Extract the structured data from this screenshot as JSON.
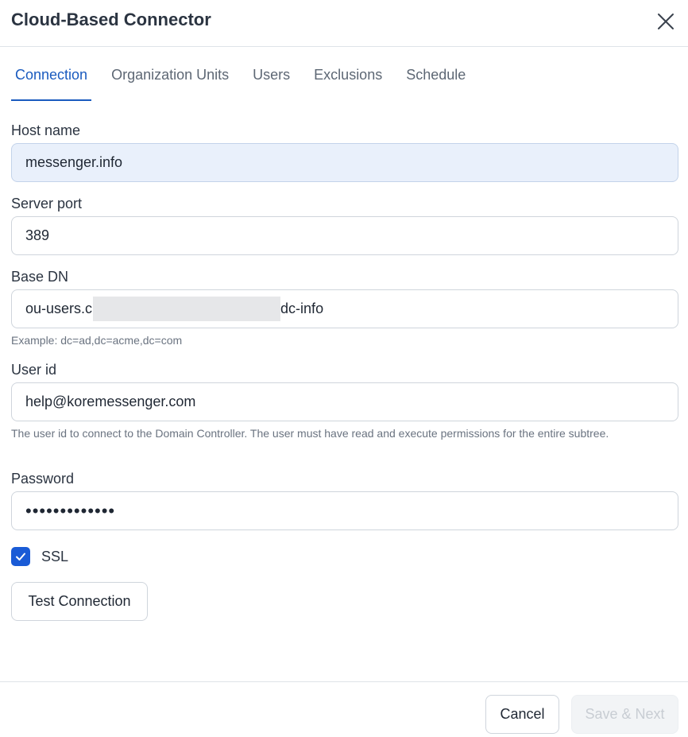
{
  "dialog": {
    "title": "Cloud-Based Connector"
  },
  "tabs": [
    {
      "label": "Connection",
      "active": true
    },
    {
      "label": "Organization Units",
      "active": false
    },
    {
      "label": "Users",
      "active": false
    },
    {
      "label": "Exclusions",
      "active": false
    },
    {
      "label": "Schedule",
      "active": false
    }
  ],
  "form": {
    "host_name": {
      "label": "Host name",
      "value": "messenger.info"
    },
    "server_port": {
      "label": "Server port",
      "value": "389"
    },
    "base_dn": {
      "label": "Base DN",
      "value_prefix": "ou-users.c",
      "value_suffix": "dc-info",
      "hint": "Example: dc=ad,dc=acme,dc=com"
    },
    "user_id": {
      "label": "User id",
      "value": "help@koremessenger.com",
      "hint": "The user id to connect to the Domain Controller. The user must have read and execute permissions for the entire subtree."
    },
    "password": {
      "label": "Password",
      "value": "•••••••••••••"
    },
    "ssl": {
      "label": "SSL",
      "checked": true
    },
    "test_connection_label": "Test Connection"
  },
  "footer": {
    "cancel_label": "Cancel",
    "save_next_label": "Save & Next",
    "save_next_enabled": false
  },
  "colors": {
    "accent": "#1a5bbf",
    "checkbox": "#1a5bd6",
    "focused_input_bg": "#e9f0fb",
    "disabled_text": "#c8cdd3"
  },
  "icons": {
    "close": "close-icon",
    "checkmark": "checkmark-icon"
  }
}
